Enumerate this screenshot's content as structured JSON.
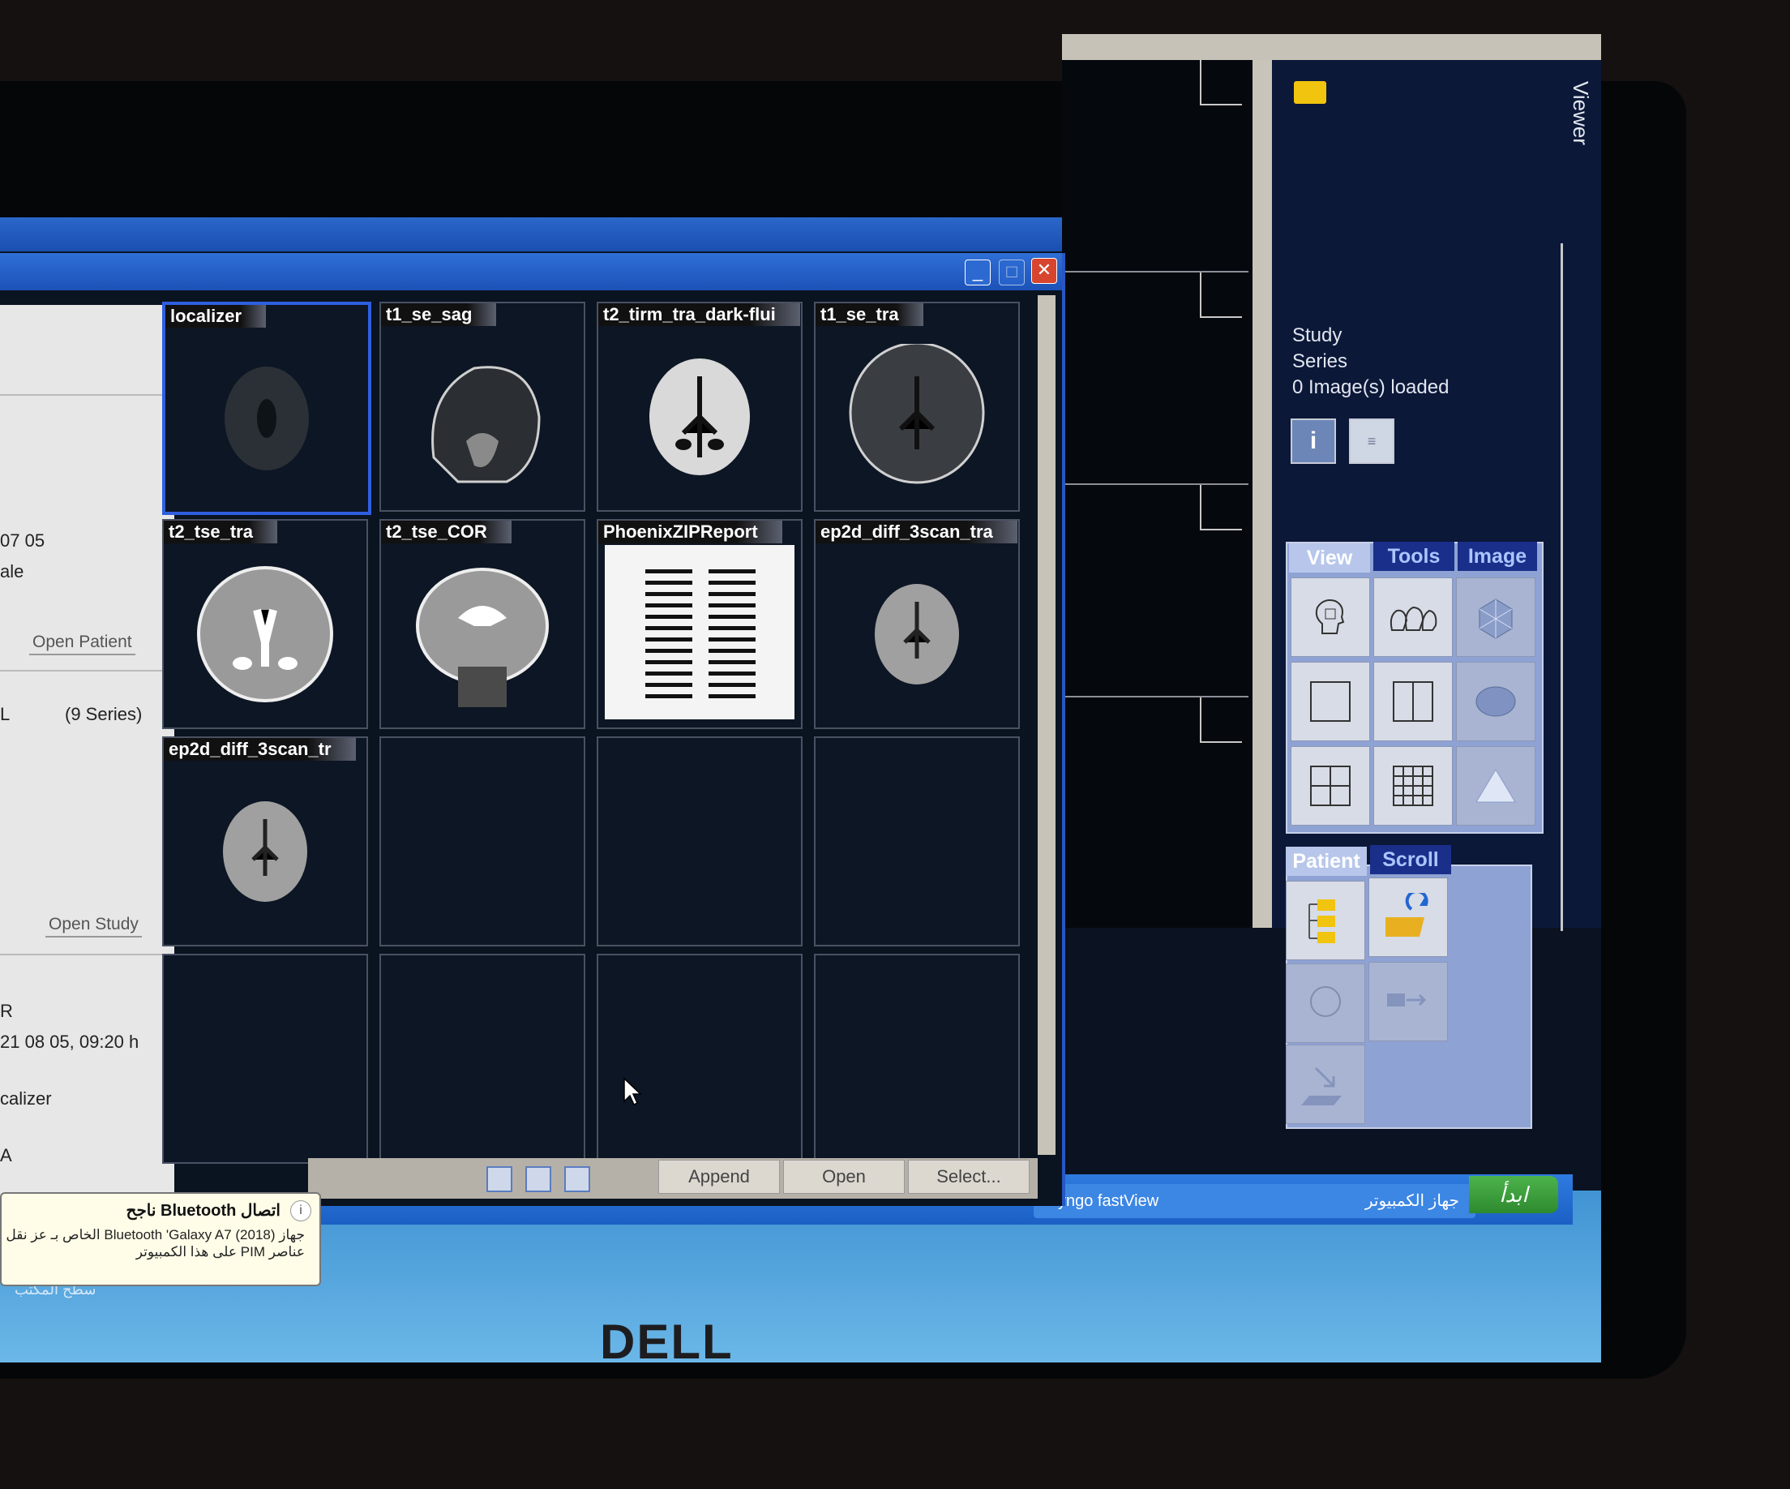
{
  "main_window": {
    "controls": {
      "minimize": "_",
      "restore": "❐",
      "close": "✕"
    },
    "viewer_tab": "Viewer",
    "info": {
      "study": "Study",
      "series": "Series",
      "loaded": "0 Image(s) loaded"
    },
    "info_buttons": {
      "info_icon": "info-icon",
      "index_icon": "index-icon"
    },
    "tabs_top": [
      {
        "label": "View",
        "active": true
      },
      {
        "label": "Tools",
        "active": false
      },
      {
        "label": "Image",
        "active": false
      }
    ],
    "tabs_bottom": [
      {
        "label": "Patient",
        "active": true
      },
      {
        "label": "Scroll",
        "active": false
      }
    ]
  },
  "browser_window": {
    "controls": {
      "minimize": "_",
      "restore": "□",
      "close": "✕"
    },
    "left_pane": {
      "date": "07 05",
      "sex": "ale",
      "open_patient": "Open Patient",
      "series_prefix": "L",
      "series_count": "(9 Series)",
      "open_study": "Open Study",
      "modality": "R",
      "datetime": "21 08 05, 09:20 h",
      "series_name": "calizer",
      "last": "A"
    },
    "thumbnails": [
      {
        "label": "localizer",
        "kind": "axial-dark",
        "selected": true
      },
      {
        "label": "t1_se_sag",
        "kind": "sagittal"
      },
      {
        "label": "t2_tirm_tra_dark-flui",
        "kind": "axial-bright"
      },
      {
        "label": "t1_se_tra",
        "kind": "axial-gray"
      },
      {
        "label": "t2_tse_tra",
        "kind": "axial-t2"
      },
      {
        "label": "t2_tse_COR",
        "kind": "coronal"
      },
      {
        "label": "PhoenixZIPReport",
        "kind": "report"
      },
      {
        "label": "ep2d_diff_3scan_tra",
        "kind": "axial-small"
      },
      {
        "label": "ep2d_diff_3scan_tr",
        "kind": "axial-small"
      }
    ],
    "bottom_buttons": {
      "append": "Append",
      "open": "Open",
      "select": "Select..."
    }
  },
  "taskbar": {
    "fastview": "syngo fastView",
    "computer": "جهاز الكمبيوتر",
    "start": "ابدأ"
  },
  "notification": {
    "title": "اتصال Bluetooth ناجح",
    "body": "جهاز (Bluetooth 'Galaxy A7 (2018 الخاص بـ عز نقل عناصر PIM على هذا الكمبيوتر",
    "info": "i"
  },
  "desktop_label": "سطح المكتب",
  "colors": {
    "accent_blue": "#2f5fe0",
    "title_blue": "#1c52b8",
    "panel_blue": "#8ea2d4",
    "start_green": "#3aa03a"
  }
}
